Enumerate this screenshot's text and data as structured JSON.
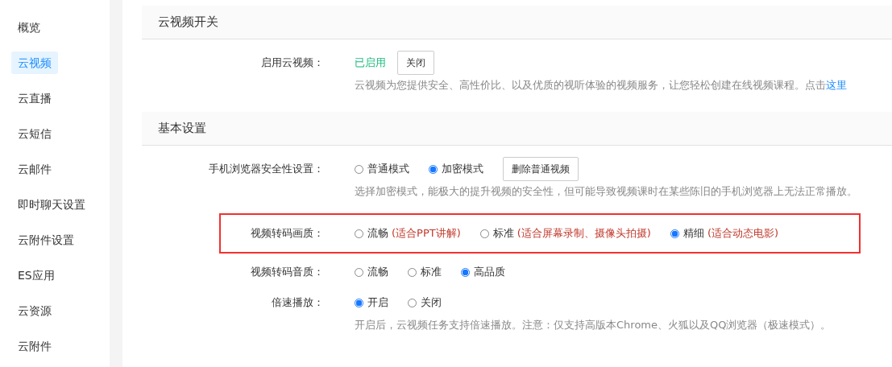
{
  "sidebar": {
    "items": [
      {
        "label": "概览",
        "selected": false
      },
      {
        "label": "云视频",
        "selected": true
      },
      {
        "label": "云直播",
        "selected": false
      },
      {
        "label": "云短信",
        "selected": false
      },
      {
        "label": "云邮件",
        "selected": false
      },
      {
        "label": "即时聊天设置",
        "selected": false
      },
      {
        "label": "云附件设置",
        "selected": false
      },
      {
        "label": "ES应用",
        "selected": false
      },
      {
        "label": "云资源",
        "selected": false
      },
      {
        "label": "云附件",
        "selected": false
      }
    ]
  },
  "sections": [
    {
      "title": "云视频开关",
      "rows": [
        {
          "kind": "status",
          "label": "启用云视频：",
          "status": "已启用",
          "button": "关闭",
          "description": "云视频为您提供安全、高性价比、以及优质的视听体验的视频服务，让您轻松创建在线视频课程。点击",
          "link": "这里"
        }
      ]
    },
    {
      "title": "基本设置",
      "rows": [
        {
          "kind": "radios",
          "label": "手机浏览器安全性设置：",
          "highlighted": false,
          "options": [
            {
              "label": "普通模式",
              "selected": false
            },
            {
              "label": "加密模式",
              "selected": true
            }
          ],
          "button": "删除普通视频",
          "description": "选择加密模式，能极大的提升视频的安全性，但可能导致视频课时在某些陈旧的手机浏览器上无法正常播放。"
        },
        {
          "kind": "radios",
          "label": "视频转码画质：",
          "highlighted": true,
          "options": [
            {
              "label": "流畅",
              "note": "(适合PPT讲解)",
              "selected": false
            },
            {
              "label": "标准",
              "note": "(适合屏幕录制、摄像头拍摄)",
              "selected": false
            },
            {
              "label": "精细",
              "note": "(适合动态电影)",
              "selected": true
            }
          ]
        },
        {
          "kind": "radios",
          "label": "视频转码音质：",
          "highlighted": false,
          "options": [
            {
              "label": "流畅",
              "selected": false
            },
            {
              "label": "标准",
              "selected": false
            },
            {
              "label": "高品质",
              "selected": true
            }
          ]
        },
        {
          "kind": "radios",
          "label": "倍速播放：",
          "highlighted": false,
          "options": [
            {
              "label": "开启",
              "selected": true
            },
            {
              "label": "关闭",
              "selected": false
            }
          ],
          "description": "开启后，云视频任务支持倍速播放。注意：仅支持高版本Chrome、火狐以及QQ浏览器（极速模式）。"
        }
      ]
    }
  ]
}
